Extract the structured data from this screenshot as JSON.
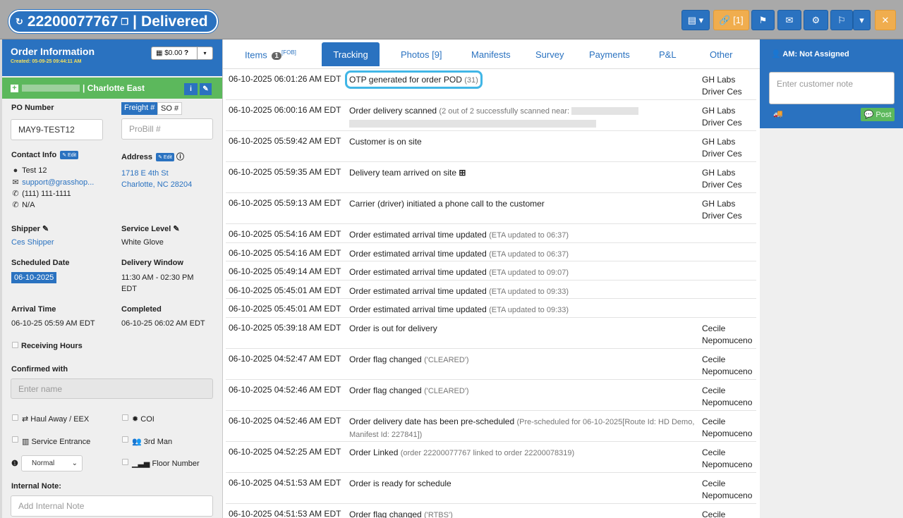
{
  "header": {
    "order_number": "22200077767",
    "status": "Delivered",
    "separator": "|",
    "links_label": "[1]"
  },
  "order_info": {
    "title": "Order Information",
    "created": "Created: 05-09-25 09:44:11 AM",
    "amount": "$0.00",
    "region": "| Charlotte East",
    "po_label": "PO Number",
    "po_value": "MAY9-TEST12",
    "freight_tab": "Freight #",
    "so_tab": "SO #",
    "probill_placeholder": "ProBill #",
    "contact_label": "Contact Info",
    "edit_label": "Edit",
    "contact_name": "Test 12",
    "contact_email": "support@grasshop...",
    "contact_phone": "(111) 111-1111",
    "contact_alt": "N/A",
    "address_label": "Address",
    "address_line1": "1718 E 4th St",
    "address_line2": "Charlotte, NC 28204",
    "shipper_label": "Shipper",
    "shipper_value": "Ces Shipper",
    "service_label": "Service Level",
    "service_value": "White Glove",
    "scheduled_label": "Scheduled Date",
    "scheduled_value": "06-10-2025",
    "window_label": "Delivery Window",
    "window_value1": "11:30 AM - 02:30 PM",
    "window_value2": "EDT",
    "arrival_label": "Arrival Time",
    "arrival_value": "06-10-25 05:59 AM EDT",
    "completed_label": "Completed",
    "completed_value": "06-10-25 06:02 AM EDT",
    "receiving_label": "Receiving Hours",
    "confirmed_label": "Confirmed with",
    "confirmed_placeholder": "Enter name",
    "haul_label": "Haul Away / EEX",
    "coi_label": "COI",
    "service_entrance_label": "Service Entrance",
    "third_man_label": "3rd Man",
    "priority_value": "Normal",
    "floor_label": "Floor Number",
    "internal_note_label": "Internal Note:",
    "internal_note_placeholder": "Add Internal Note"
  },
  "tabs": [
    {
      "label": "Items",
      "count": "1",
      "sup": "[FOB]"
    },
    {
      "label": "Tracking"
    },
    {
      "label": "Photos [9]"
    },
    {
      "label": "Manifests"
    },
    {
      "label": "Survey"
    },
    {
      "label": "Payments"
    },
    {
      "label": "P&L"
    },
    {
      "label": "Other"
    }
  ],
  "tracking": [
    {
      "time": "06-10-2025 06:01:26 AM EDT",
      "event": "OTP generated for order POD",
      "detail": "(31)",
      "by1": "GH Labs",
      "by2": "Driver Ces"
    },
    {
      "time": "06-10-2025 06:00:16 AM EDT",
      "event": "Order delivery scanned",
      "detail": "(2 out of 2 successfully scanned near:",
      "by1": "GH Labs",
      "by2": "Driver Ces"
    },
    {
      "time": "06-10-2025 05:59:42 AM EDT",
      "event": "Customer is on site",
      "detail": "",
      "by1": "GH Labs",
      "by2": "Driver Ces"
    },
    {
      "time": "06-10-2025 05:59:35 AM EDT",
      "event": "Delivery team arrived on site",
      "detail": "",
      "by1": "GH Labs",
      "by2": "Driver Ces"
    },
    {
      "time": "06-10-2025 05:59:13 AM EDT",
      "event": "Carrier (driver) initiated a phone call to the customer",
      "detail": "",
      "by1": "GH Labs",
      "by2": "Driver Ces"
    },
    {
      "time": "06-10-2025 05:54:16 AM EDT",
      "event": "Order estimated arrival time updated",
      "detail": "(ETA updated to 06:37)",
      "by1": "",
      "by2": ""
    },
    {
      "time": "06-10-2025 05:54:16 AM EDT",
      "event": "Order estimated arrival time updated",
      "detail": "(ETA updated to 06:37)",
      "by1": "",
      "by2": ""
    },
    {
      "time": "06-10-2025 05:49:14 AM EDT",
      "event": "Order estimated arrival time updated",
      "detail": "(ETA updated to 09:07)",
      "by1": "",
      "by2": ""
    },
    {
      "time": "06-10-2025 05:45:01 AM EDT",
      "event": "Order estimated arrival time updated",
      "detail": "(ETA updated to 09:33)",
      "by1": "",
      "by2": ""
    },
    {
      "time": "06-10-2025 05:45:01 AM EDT",
      "event": "Order estimated arrival time updated",
      "detail": "(ETA updated to 09:33)",
      "by1": "",
      "by2": ""
    },
    {
      "time": "06-10-2025 05:39:18 AM EDT",
      "event": "Order is out for delivery",
      "detail": "",
      "by1": "Cecile",
      "by2": "Nepomuceno"
    },
    {
      "time": "06-10-2025 04:52:47 AM EDT",
      "event": "Order flag changed",
      "detail": "('CLEARED')",
      "by1": "Cecile",
      "by2": "Nepomuceno"
    },
    {
      "time": "06-10-2025 04:52:46 AM EDT",
      "event": "Order flag changed",
      "detail": "('CLEARED')",
      "by1": "Cecile",
      "by2": "Nepomuceno"
    },
    {
      "time": "06-10-2025 04:52:46 AM EDT",
      "event": "Order delivery date has been pre-scheduled",
      "detail": "(Pre-scheduled for 06-10-2025[Route Id: HD Demo, Manifest Id: 227841])",
      "by1": "Cecile",
      "by2": "Nepomuceno"
    },
    {
      "time": "06-10-2025 04:52:25 AM EDT",
      "event": "Order Linked",
      "detail": "(order 22200077767 linked to order 22200078319)",
      "by1": "Cecile",
      "by2": "Nepomuceno"
    },
    {
      "time": "06-10-2025 04:51:53 AM EDT",
      "event": "Order is ready for schedule",
      "detail": "",
      "by1": "Cecile",
      "by2": "Nepomuceno"
    },
    {
      "time": "06-10-2025 04:51:53 AM EDT",
      "event": "Order flag changed",
      "detail": "('RTBS')",
      "by1": "Cecile",
      "by2": ""
    }
  ],
  "account": {
    "am_label": "AM: Not Assigned",
    "note_placeholder": "Enter customer note",
    "post_label": "Post"
  }
}
